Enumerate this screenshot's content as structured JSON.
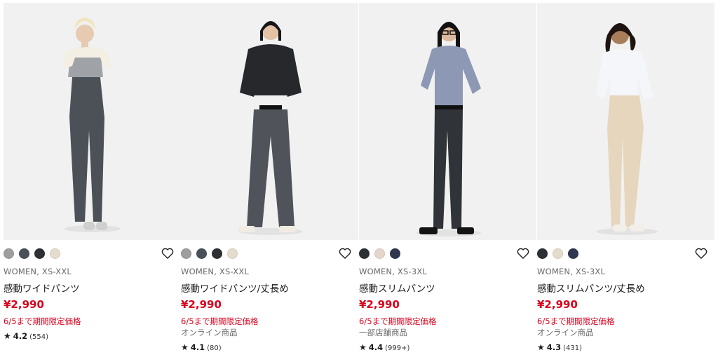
{
  "products": [
    {
      "swatches": [
        "#9e9e9e",
        "#4a5058",
        "#2c2f33",
        "#e4dccd"
      ],
      "meta": "WOMEN, XS-XXL",
      "name": "感動ワイドパンツ",
      "price": "¥2,990",
      "promo": "6/5まで期間限定価格",
      "note": "",
      "rating": "4.2",
      "count": "(554)"
    },
    {
      "swatches": [
        "#9e9e9e",
        "#4a5058",
        "#2c2f33",
        "#e4dccd"
      ],
      "meta": "WOMEN, XS-XXL",
      "name": "感動ワイドパンツ/丈長め",
      "price": "¥2,990",
      "promo": "6/5まで期間限定価格",
      "note": "オンライン商品",
      "rating": "4.1",
      "count": "(80)"
    },
    {
      "swatches": [
        "#2c2f33",
        "#e4d6cb",
        "#2e3650"
      ],
      "meta": "WOMEN, XS-3XL",
      "name": "感動スリムパンツ",
      "price": "¥2,990",
      "promo": "6/5まで期間限定価格",
      "note": "一部店舗商品",
      "rating": "4.4",
      "count": "(999+)"
    },
    {
      "swatches": [
        "#2c2f33",
        "#e4dccd",
        "#2e3650"
      ],
      "meta": "WOMEN, XS-3XL",
      "name": "感動スリムパンツ/丈長め",
      "price": "¥2,990",
      "promo": "6/5まで期間限定価格",
      "note": "オンライン商品",
      "rating": "4.3",
      "count": "(431)"
    }
  ],
  "icons": {
    "favorite": "heart-outline-icon",
    "rating": "star-icon"
  },
  "colors": {
    "price": "#d8001c",
    "promo": "#d8001c",
    "meta": "#6b6b6b"
  }
}
